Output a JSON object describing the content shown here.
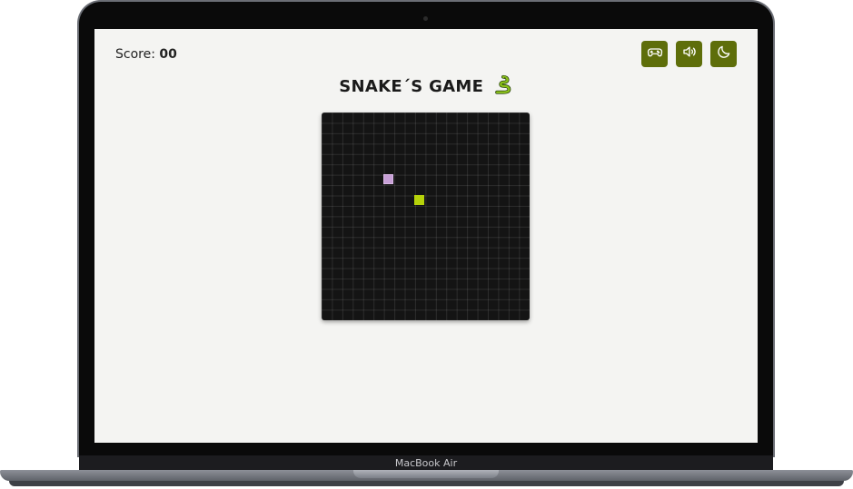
{
  "device": {
    "model_label": "MacBook Air"
  },
  "game": {
    "score_label": "Score: ",
    "score_value": "00",
    "title": "SNAKE´S GAME",
    "title_emoji": "snake-icon",
    "buttons": [
      {
        "icon": "gamepad-icon",
        "name": "controls-button"
      },
      {
        "icon": "volume-icon",
        "name": "sound-button"
      },
      {
        "icon": "moon-icon",
        "name": "dark-mode-button"
      }
    ],
    "colors": {
      "button_bg": "#5e6e0a",
      "board_bg": "#141414",
      "food": "#c79fd6",
      "snake": "#b6d20a",
      "screen_bg": "#f4f4f2"
    }
  }
}
